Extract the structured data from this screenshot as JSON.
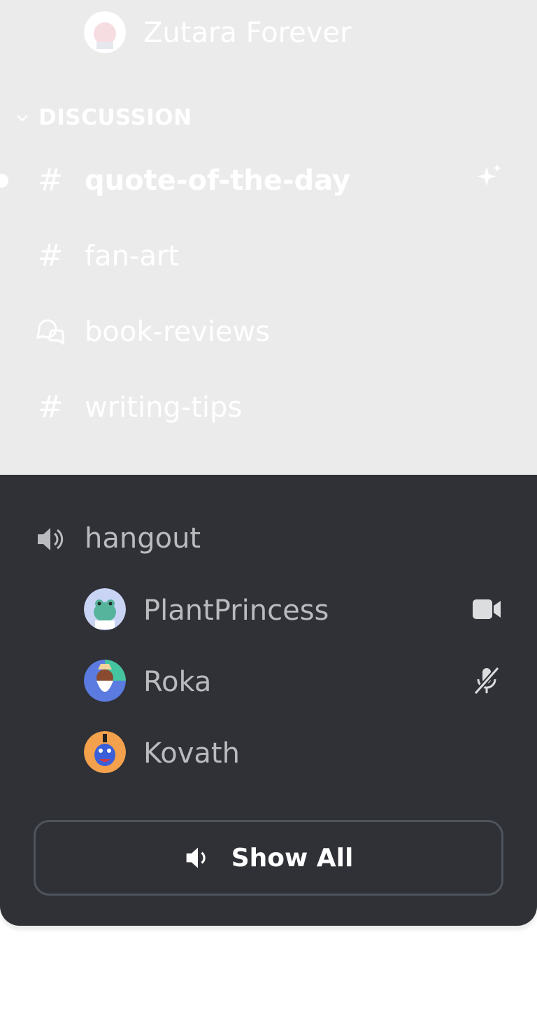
{
  "server_item": {
    "name": "Zutara Forever"
  },
  "category": {
    "name": "DISCUSSION"
  },
  "channels": [
    {
      "name": "quote-of-the-day",
      "type": "text",
      "unread": true
    },
    {
      "name": "fan-art",
      "type": "text"
    },
    {
      "name": "book-reviews",
      "type": "forum"
    },
    {
      "name": "writing-tips",
      "type": "text"
    }
  ],
  "voice_channel": {
    "name": "hangout",
    "members": [
      {
        "name": "PlantPrincess",
        "status_icon": "video-camera-icon"
      },
      {
        "name": "Roka",
        "status_icon": "muted-microphone-icon"
      },
      {
        "name": "Kovath",
        "status_icon": ""
      }
    ]
  },
  "show_all_button": {
    "label": "Show All"
  },
  "colors": {
    "panel_dark": "#2f3136",
    "panel_light": "#ebebeb",
    "text_muted": "#b9bbbe",
    "button_border": "#4f545c"
  }
}
